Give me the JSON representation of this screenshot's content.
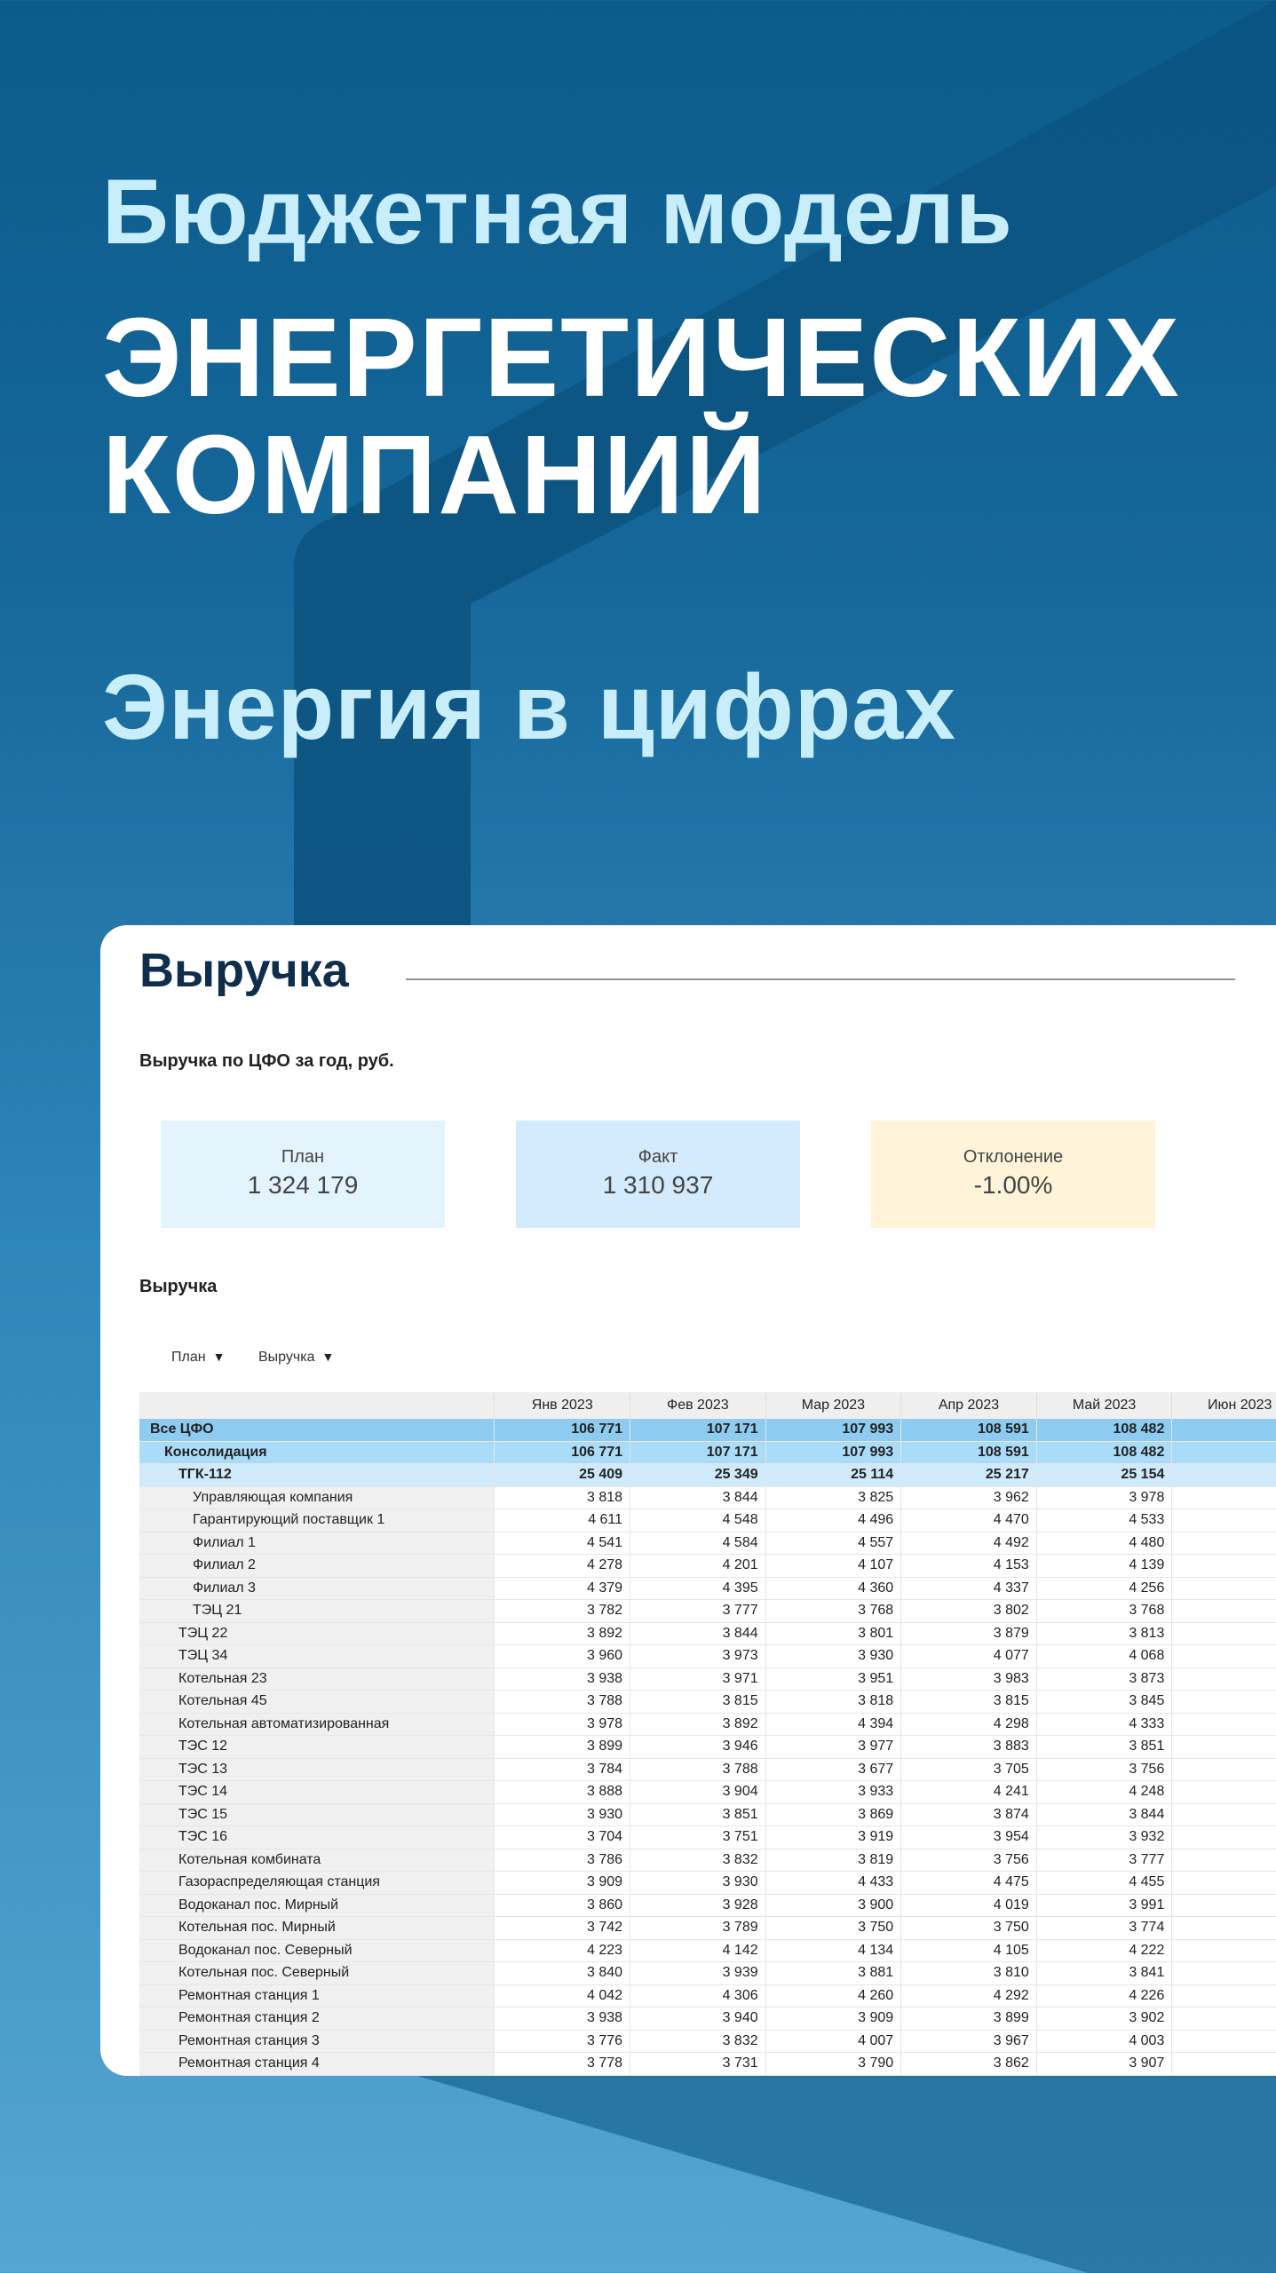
{
  "hero": {
    "line1": "Бюджетная модель",
    "line2": "ЭНЕРГЕТИЧЕСКИХ",
    "line3": "КОМПАНИЙ",
    "line4": "Энергия в цифрах"
  },
  "card": {
    "title": "Выручка",
    "subtitle": "Выручка по ЦФО за год, руб.",
    "kpis": [
      {
        "label": "План",
        "value": "1 324 179",
        "color": "#e3f4fd"
      },
      {
        "label": "Факт",
        "value": "1 310 937",
        "color": "#d3ebfc"
      },
      {
        "label": "Отклонение",
        "value": "-1.00%",
        "color": "#fff3d9"
      }
    ],
    "section_title": "Выручка",
    "filters": [
      {
        "label": "План"
      },
      {
        "label": "Выручка"
      }
    ]
  },
  "table": {
    "columns": [
      "",
      "Янв 2023",
      "Фев 2023",
      "Мар 2023",
      "Апр 2023",
      "Май 2023",
      "Июн 2023"
    ],
    "rows": [
      {
        "name": "Все ЦФО",
        "level": 0,
        "style": "l0",
        "values": [
          "106 771",
          "107 171",
          "107 993",
          "108 591",
          "108 482"
        ]
      },
      {
        "name": "Консолидация",
        "level": 1,
        "style": "l1",
        "values": [
          "106 771",
          "107 171",
          "107 993",
          "108 591",
          "108 482"
        ]
      },
      {
        "name": "ТГК-112",
        "level": 2,
        "style": "l2b",
        "values": [
          "25 409",
          "25 349",
          "25 114",
          "25 217",
          "25 154"
        ]
      },
      {
        "name": "Управляющая компания",
        "level": 3,
        "style": "",
        "values": [
          "3 818",
          "3 844",
          "3 825",
          "3 962",
          "3 978"
        ]
      },
      {
        "name": "Гарантирующий поставщик 1",
        "level": 3,
        "style": "",
        "values": [
          "4 611",
          "4 548",
          "4 496",
          "4 470",
          "4 533"
        ]
      },
      {
        "name": "Филиал 1",
        "level": 3,
        "style": "",
        "values": [
          "4 541",
          "4 584",
          "4 557",
          "4 492",
          "4 480"
        ]
      },
      {
        "name": "Филиал 2",
        "level": 3,
        "style": "",
        "values": [
          "4 278",
          "4 201",
          "4 107",
          "4 153",
          "4 139"
        ]
      },
      {
        "name": "Филиал 3",
        "level": 3,
        "style": "",
        "values": [
          "4 379",
          "4 395",
          "4 360",
          "4 337",
          "4 256"
        ]
      },
      {
        "name": "ТЭЦ 21",
        "level": 3,
        "style": "",
        "values": [
          "3 782",
          "3 777",
          "3 768",
          "3 802",
          "3 768"
        ]
      },
      {
        "name": "ТЭЦ 22",
        "level": 2,
        "style": "",
        "values": [
          "3 892",
          "3 844",
          "3 801",
          "3 879",
          "3 813"
        ]
      },
      {
        "name": "ТЭЦ 34",
        "level": 2,
        "style": "",
        "values": [
          "3 960",
          "3 973",
          "3 930",
          "4 077",
          "4 068"
        ]
      },
      {
        "name": "Котельная 23",
        "level": 2,
        "style": "",
        "values": [
          "3 938",
          "3 971",
          "3 951",
          "3 983",
          "3 873"
        ]
      },
      {
        "name": "Котельная 45",
        "level": 2,
        "style": "",
        "values": [
          "3 788",
          "3 815",
          "3 818",
          "3 815",
          "3 845"
        ]
      },
      {
        "name": "Котельная автоматизированная",
        "level": 2,
        "style": "",
        "values": [
          "3 978",
          "3 892",
          "4 394",
          "4 298",
          "4 333"
        ]
      },
      {
        "name": "ТЭС 12",
        "level": 2,
        "style": "",
        "values": [
          "3 899",
          "3 946",
          "3 977",
          "3 883",
          "3 851"
        ]
      },
      {
        "name": "ТЭС 13",
        "level": 2,
        "style": "",
        "values": [
          "3 784",
          "3 788",
          "3 677",
          "3 705",
          "3 756"
        ]
      },
      {
        "name": "ТЭС 14",
        "level": 2,
        "style": "",
        "values": [
          "3 888",
          "3 904",
          "3 933",
          "4 241",
          "4 248"
        ]
      },
      {
        "name": "ТЭС 15",
        "level": 2,
        "style": "",
        "values": [
          "3 930",
          "3 851",
          "3 869",
          "3 874",
          "3 844"
        ]
      },
      {
        "name": "ТЭС 16",
        "level": 2,
        "style": "",
        "values": [
          "3 704",
          "3 751",
          "3 919",
          "3 954",
          "3 932"
        ]
      },
      {
        "name": "Котельная комбината",
        "level": 2,
        "style": "",
        "values": [
          "3 786",
          "3 832",
          "3 819",
          "3 756",
          "3 777"
        ]
      },
      {
        "name": "Газораспределяющая станция",
        "level": 2,
        "style": "",
        "values": [
          "3 909",
          "3 930",
          "4 433",
          "4 475",
          "4 455"
        ]
      },
      {
        "name": "Водоканал пос. Мирный",
        "level": 2,
        "style": "",
        "values": [
          "3 860",
          "3 928",
          "3 900",
          "4 019",
          "3 991"
        ]
      },
      {
        "name": "Котельная пос. Мирный",
        "level": 2,
        "style": "",
        "values": [
          "3 742",
          "3 789",
          "3 750",
          "3 750",
          "3 774"
        ]
      },
      {
        "name": "Водоканал пос. Северный",
        "level": 2,
        "style": "",
        "values": [
          "4 223",
          "4 142",
          "4 134",
          "4 105",
          "4 222"
        ]
      },
      {
        "name": "Котельная пос. Северный",
        "level": 2,
        "style": "",
        "values": [
          "3 840",
          "3 939",
          "3 881",
          "3 810",
          "3 841"
        ]
      },
      {
        "name": "Ремонтная станция 1",
        "level": 2,
        "style": "",
        "values": [
          "4 042",
          "4 306",
          "4 260",
          "4 292",
          "4 226"
        ]
      },
      {
        "name": "Ремонтная станция 2",
        "level": 2,
        "style": "",
        "values": [
          "3 938",
          "3 940",
          "3 909",
          "3 899",
          "3 902"
        ]
      },
      {
        "name": "Ремонтная станция 3",
        "level": 2,
        "style": "",
        "values": [
          "3 776",
          "3 832",
          "4 007",
          "3 967",
          "4 003"
        ]
      },
      {
        "name": "Ремонтная станция 4",
        "level": 2,
        "style": "",
        "values": [
          "3 778",
          "3 731",
          "3 790",
          "3 862",
          "3 907"
        ]
      }
    ]
  }
}
